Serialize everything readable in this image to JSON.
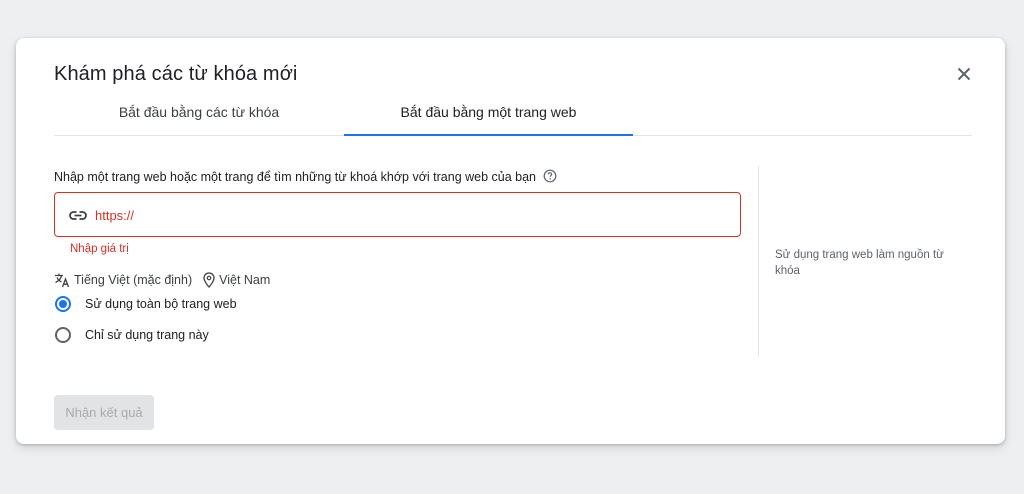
{
  "dialog": {
    "title": "Khám phá các từ khóa mới",
    "close_icon": "close-icon"
  },
  "tabs": [
    {
      "label": "Bắt đầu bằng các từ khóa",
      "active": false
    },
    {
      "label": "Bắt đầu bằng một trang web",
      "active": true
    }
  ],
  "form": {
    "prompt": "Nhập một trang web hoặc một trang để tìm những từ khoá khớp với trang web của bạn",
    "url_placeholder": "https://",
    "url_value": "",
    "error": "Nhập giá trị",
    "language": "Tiếng Việt (mặc định)",
    "location": "Việt Nam",
    "options": [
      {
        "label": "Sử dụng toàn bộ trang web",
        "checked": true
      },
      {
        "label": "Chỉ sử dụng trang này",
        "checked": false
      }
    ]
  },
  "side_note": "Sử dụng trang web làm nguồn từ khóa",
  "submit_label": "Nhận kết quả",
  "colors": {
    "accent": "#1a73e8",
    "error": "#d93025",
    "background": "#eeeff1"
  }
}
